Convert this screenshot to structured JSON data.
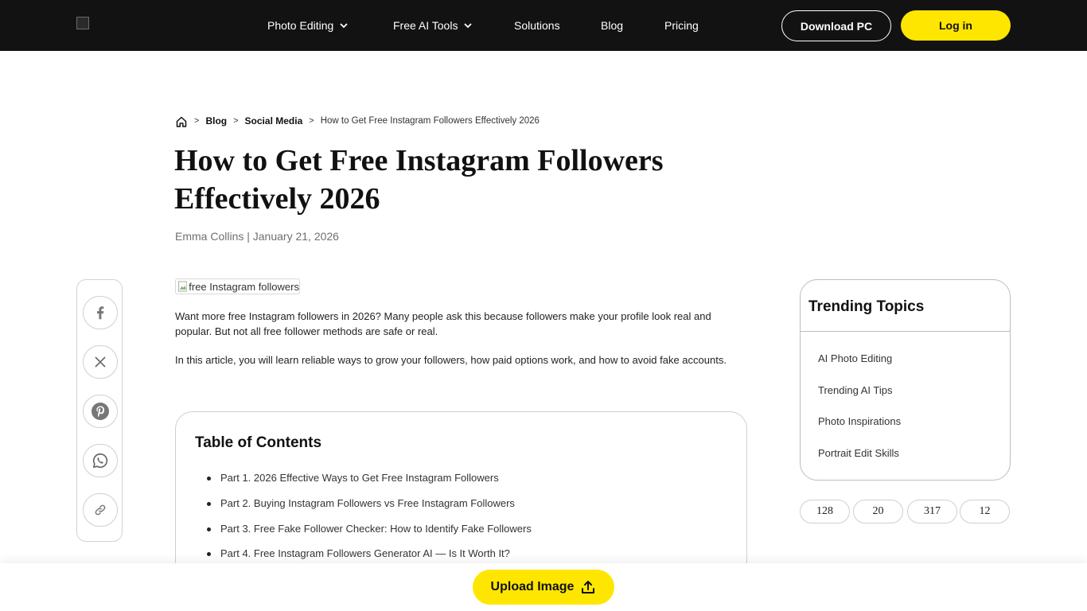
{
  "header": {
    "nav": [
      {
        "label": "Photo Editing",
        "has_dropdown": true
      },
      {
        "label": "Free AI Tools",
        "has_dropdown": true
      },
      {
        "label": "Solutions",
        "has_dropdown": false
      },
      {
        "label": "Blog",
        "has_dropdown": false
      },
      {
        "label": "Pricing",
        "has_dropdown": false
      }
    ],
    "download_label": "Download PC",
    "login_label": "Log in",
    "accent_color": "#ffe600",
    "background_color": "#121212"
  },
  "breadcrumb": {
    "home_icon": "home-icon",
    "items": [
      "Blog",
      "Social Media",
      "How to Get Free Instagram Followers Effectively 2026"
    ],
    "separator": ">"
  },
  "article": {
    "title_line1": "How to Get Free Instagram Followers",
    "title_line2": "Effectively 2026",
    "byline": "Emma Collins | January 21, 2026",
    "hero_alt": "free Instagram followers",
    "paragraphs": [
      "Want more free Instagram followers in 2026? Many people ask this because followers make your profile look real and popular. But not all free follower methods are safe or real.",
      "In this article, you will learn reliable ways to grow your followers, how paid options work, and how to avoid fake accounts."
    ]
  },
  "toc": {
    "title": "Table of Contents",
    "items": [
      "Part 1. 2026 Effective Ways to Get Free Instagram Followers",
      "Part 2. Buying Instagram Followers vs Free Instagram Followers",
      "Part 3. Free Fake Follower Checker: How to Identify Fake Followers",
      "Part 4. Free Instagram Followers Generator AI — Is It Worth It?"
    ]
  },
  "share": {
    "icons": [
      "facebook-icon",
      "x-icon",
      "pinterest-icon",
      "whatsapp-icon",
      "link-icon"
    ]
  },
  "trending": {
    "title": "Trending Topics",
    "items": [
      "AI Photo Editing",
      "Trending AI Tips",
      "Photo Inspirations",
      "Portrait Edit Skills"
    ]
  },
  "stats": [
    "128",
    "20",
    "317",
    "12"
  ],
  "bottom": {
    "upload_label": "Upload Image",
    "upload_icon": "upload-icon"
  }
}
